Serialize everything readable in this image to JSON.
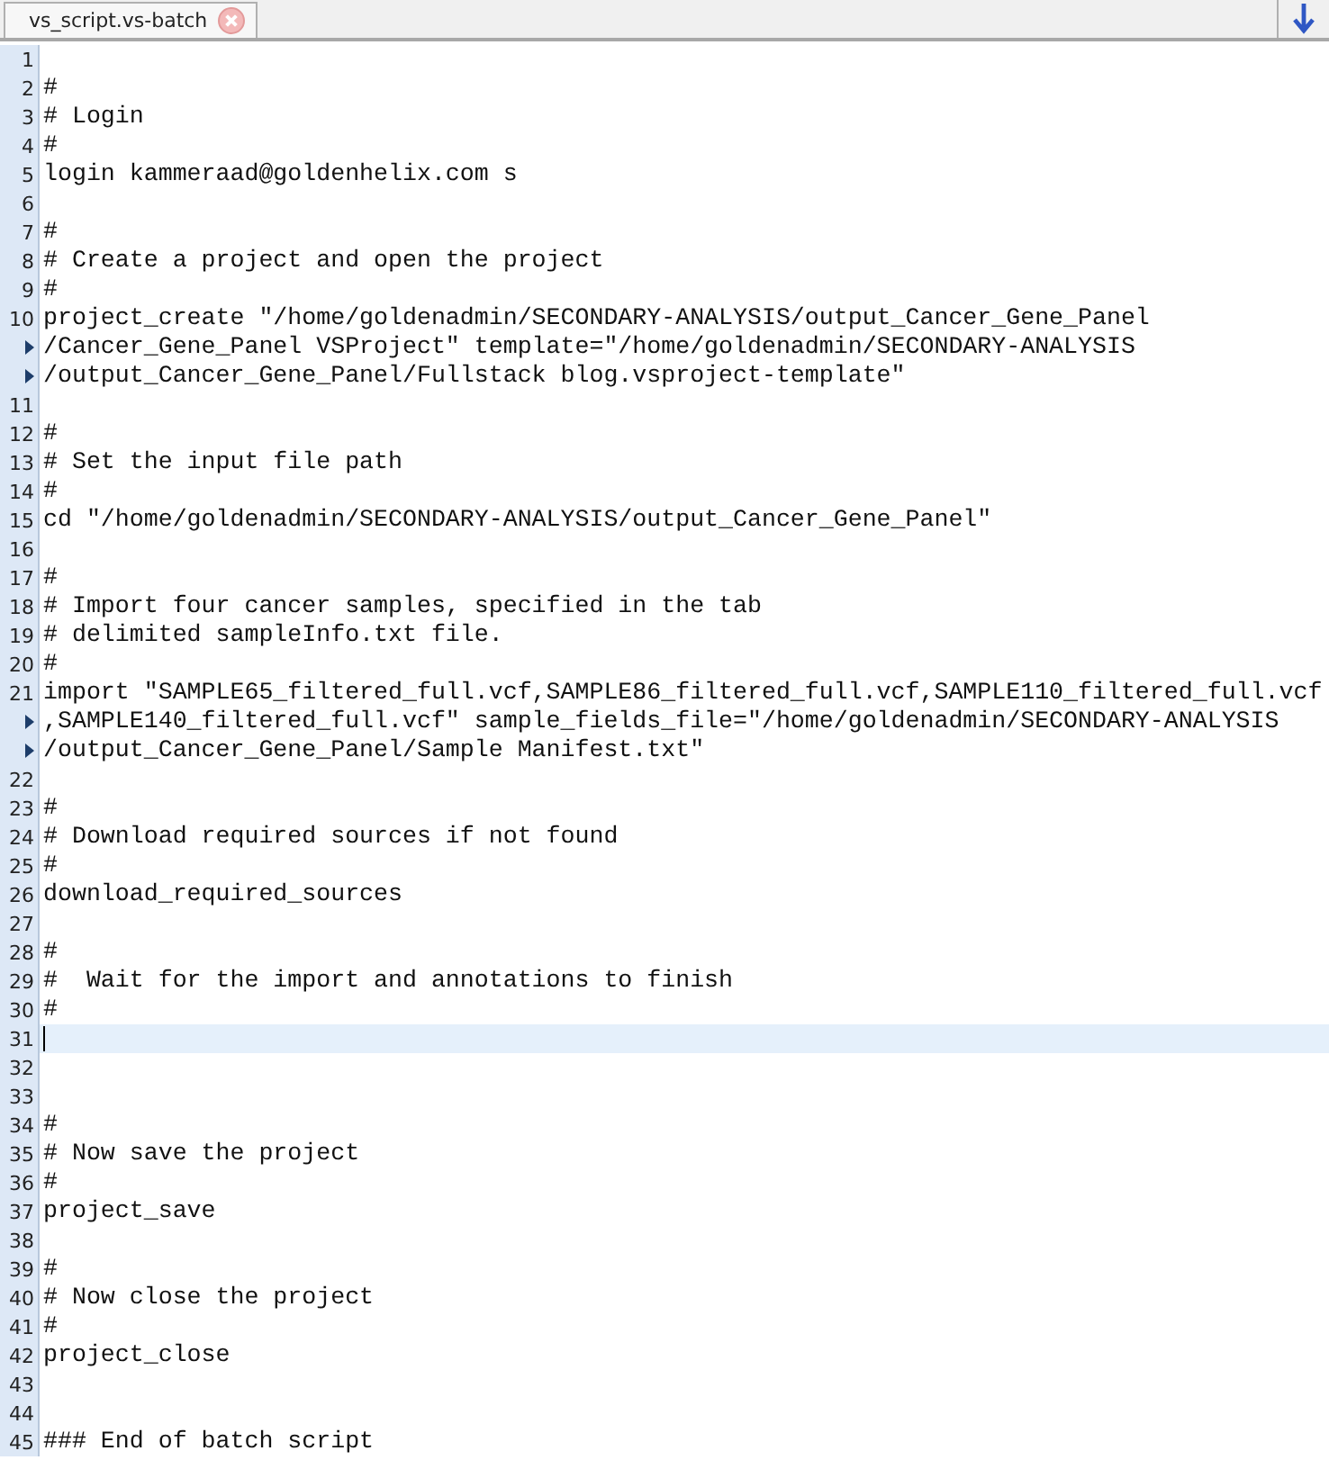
{
  "tabs": [
    {
      "label": "vs_script.vs-batch",
      "selected": true
    }
  ],
  "editor": {
    "lines": [
      {
        "number": "1",
        "current": false,
        "rows": [
          ""
        ]
      },
      {
        "number": "2",
        "current": false,
        "rows": [
          "#"
        ]
      },
      {
        "number": "3",
        "current": false,
        "rows": [
          "# Login"
        ]
      },
      {
        "number": "4",
        "current": false,
        "rows": [
          "#"
        ]
      },
      {
        "number": "5",
        "current": false,
        "rows": [
          "login kammeraad@goldenhelix.com s"
        ]
      },
      {
        "number": "6",
        "current": false,
        "rows": [
          ""
        ]
      },
      {
        "number": "7",
        "current": false,
        "rows": [
          "#"
        ]
      },
      {
        "number": "8",
        "current": false,
        "rows": [
          "# Create a project and open the project"
        ]
      },
      {
        "number": "9",
        "current": false,
        "rows": [
          "#"
        ]
      },
      {
        "number": "10",
        "current": false,
        "rows": [
          "project_create \"/home/goldenadmin/SECONDARY-ANALYSIS/output_Cancer_Gene_Panel",
          "/Cancer_Gene_Panel VSProject\" template=\"/home/goldenadmin/SECONDARY-ANALYSIS",
          "/output_Cancer_Gene_Panel/Fullstack blog.vsproject-template\""
        ]
      },
      {
        "number": "11",
        "current": false,
        "rows": [
          ""
        ]
      },
      {
        "number": "12",
        "current": false,
        "rows": [
          "#"
        ]
      },
      {
        "number": "13",
        "current": false,
        "rows": [
          "# Set the input file path"
        ]
      },
      {
        "number": "14",
        "current": false,
        "rows": [
          "#"
        ]
      },
      {
        "number": "15",
        "current": false,
        "rows": [
          "cd \"/home/goldenadmin/SECONDARY-ANALYSIS/output_Cancer_Gene_Panel\""
        ]
      },
      {
        "number": "16",
        "current": false,
        "rows": [
          ""
        ]
      },
      {
        "number": "17",
        "current": false,
        "rows": [
          "#"
        ]
      },
      {
        "number": "18",
        "current": false,
        "rows": [
          "# Import four cancer samples, specified in the tab"
        ]
      },
      {
        "number": "19",
        "current": false,
        "rows": [
          "# delimited sampleInfo.txt file."
        ]
      },
      {
        "number": "20",
        "current": false,
        "rows": [
          "#"
        ]
      },
      {
        "number": "21",
        "current": false,
        "rows": [
          "import \"SAMPLE65_filtered_full.vcf,SAMPLE86_filtered_full.vcf,SAMPLE110_filtered_full.vcf",
          ",SAMPLE140_filtered_full.vcf\" sample_fields_file=\"/home/goldenadmin/SECONDARY-ANALYSIS",
          "/output_Cancer_Gene_Panel/Sample Manifest.txt\""
        ]
      },
      {
        "number": "22",
        "current": false,
        "rows": [
          ""
        ]
      },
      {
        "number": "23",
        "current": false,
        "rows": [
          "#"
        ]
      },
      {
        "number": "24",
        "current": false,
        "rows": [
          "# Download required sources if not found"
        ]
      },
      {
        "number": "25",
        "current": false,
        "rows": [
          "#"
        ]
      },
      {
        "number": "26",
        "current": false,
        "rows": [
          "download_required_sources"
        ]
      },
      {
        "number": "27",
        "current": false,
        "rows": [
          ""
        ]
      },
      {
        "number": "28",
        "current": false,
        "rows": [
          "#"
        ]
      },
      {
        "number": "29",
        "current": false,
        "rows": [
          "#  Wait for the import and annotations to finish"
        ]
      },
      {
        "number": "30",
        "current": false,
        "rows": [
          "#"
        ]
      },
      {
        "number": "31",
        "current": true,
        "rows": [
          ""
        ]
      },
      {
        "number": "32",
        "current": false,
        "rows": [
          ""
        ]
      },
      {
        "number": "33",
        "current": false,
        "rows": [
          ""
        ]
      },
      {
        "number": "34",
        "current": false,
        "rows": [
          "#"
        ]
      },
      {
        "number": "35",
        "current": false,
        "rows": [
          "# Now save the project"
        ]
      },
      {
        "number": "36",
        "current": false,
        "rows": [
          "#"
        ]
      },
      {
        "number": "37",
        "current": false,
        "rows": [
          "project_save"
        ]
      },
      {
        "number": "38",
        "current": false,
        "rows": [
          ""
        ]
      },
      {
        "number": "39",
        "current": false,
        "rows": [
          "#"
        ]
      },
      {
        "number": "40",
        "current": false,
        "rows": [
          "# Now close the project"
        ]
      },
      {
        "number": "41",
        "current": false,
        "rows": [
          "#"
        ]
      },
      {
        "number": "42",
        "current": false,
        "rows": [
          "project_close"
        ]
      },
      {
        "number": "43",
        "current": false,
        "rows": [
          ""
        ]
      },
      {
        "number": "44",
        "current": false,
        "rows": [
          ""
        ]
      },
      {
        "number": "45",
        "current": false,
        "rows": [
          "### End of batch script"
        ]
      }
    ]
  }
}
